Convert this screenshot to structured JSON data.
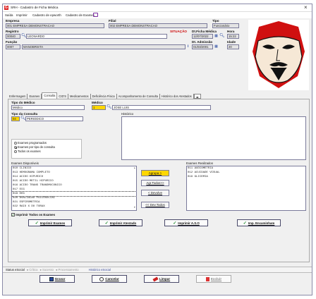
{
  "window": {
    "title": "SRH - Cadastro de Ficha Médica",
    "close_icon": "close-icon"
  },
  "menu": [
    "Saída",
    "Imprimir",
    "Cadastro de epworth",
    "Cadastro de Exames"
  ],
  "header": {
    "empresa": {
      "label": "Empresa",
      "value": "001 EMPRESA DEMONSTRACAO"
    },
    "filial": {
      "label": "Filial",
      "value": "002 EMPRESA DEMONSTRACAO"
    },
    "tipo": {
      "label": "Tipo",
      "value": "Funcionário"
    },
    "registro": {
      "label": "Registro",
      "code": "00040",
      "name": "LEONARDO"
    },
    "situacao": {
      "label": "SITUAÇÃO"
    },
    "dt_ficha": {
      "label": "Dt.Ficha Médica",
      "value": "12/07/2022"
    },
    "hora": {
      "label": "Hora",
      "value": "15:22"
    },
    "funcao": {
      "label": "Função",
      "code": "0007",
      "name": "MANOBRISTA"
    },
    "dt_admissao": {
      "label": "Dt. Admissão",
      "value": "01/03/2001"
    },
    "idade": {
      "label": "Idade",
      "value": "20"
    }
  },
  "tabs": [
    "Enfermagem",
    "Exames",
    "Consulta",
    "CID'S",
    "Medicamentos",
    "Deficiência Física",
    "Acompanhamento de Consulta",
    "Histórico dos Atestados"
  ],
  "consulta": {
    "tipo_medico": {
      "label": "Tipo do Médico",
      "value": "Médico"
    },
    "medico": {
      "label": "Médico",
      "code": "1",
      "name": "JOSE LUIS"
    },
    "tipo_consulta": {
      "label": "Tipo da Consulta",
      "code": "04",
      "name": "PERIODICO"
    },
    "historico_label": "Histórico",
    "radios": [
      "Exames programados",
      "Exames por tipo de consulta",
      "Todos os exames"
    ],
    "radio_selected": 1,
    "disponiveis_label": "Exames Disponíveis",
    "disponiveis": [
      "010 CLINICO",
      "013 HEMOGRAMA COMPLETO",
      "014 ACIDO HIPURICO",
      "015 ACIDO METIL HIPURICO",
      "016 ACIDO TRANS TRANSMUCONICO",
      "017 ECG",
      "018 EEG",
      "020 AVALIACAO PSICOSOCIAL",
      "021 ESPIROMETRIA",
      "022 RAIO X DO TORAX"
    ],
    "realizados_label": "Exames Realizados",
    "realizados": [
      "011 AUDIOMETRIA",
      "012 ACUIDADE VISUAL",
      "019 GLICEMIA"
    ],
    "btn_agrupa": "Agrupa >",
    "btn_agrupa_todos": "Agr.Todos>>",
    "btn_devolve": "< Devolve",
    "btn_devolve_todos": "<< Dev.Todos",
    "imprime_todos": "Imprimir Todos os Exames",
    "print_buttons": [
      "Imprimir Exames",
      "Imprimir Atestado",
      "Imprimir A.S.O",
      "Imp. Encaminham"
    ]
  },
  "status": {
    "label": "Status eSocial",
    "items": [
      "Crítica",
      "Sucesso",
      "Processamento"
    ],
    "link": "Histórico eSocial"
  },
  "bottom_buttons": [
    "Gravar",
    "Cancelar",
    "Limpar",
    "Excluir"
  ],
  "colors": {
    "accent": "#ffd700",
    "red": "#cc0000",
    "check": "#1d8a2a"
  }
}
